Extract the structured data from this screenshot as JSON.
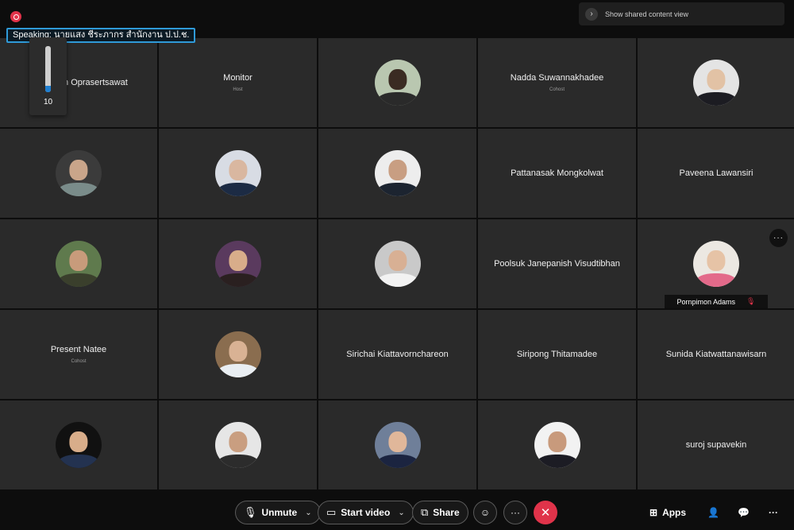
{
  "speaking_label": "Speaking: นายแสง ชีระภากร สำนักงาน ป.ป.ช.",
  "shared_content": {
    "label": "Show shared content view",
    "icon": "chevron-right-icon"
  },
  "volume": {
    "value": "10",
    "level": 0.14
  },
  "participants": [
    {
      "name": "Mongkorn Oprasertsawat",
      "role": "",
      "avatar": null
    },
    {
      "name": "Monitor",
      "role": "Host",
      "avatar": null
    },
    {
      "name": "",
      "role": "",
      "avatar": {
        "bg": "#b9c7b0",
        "skin": "#3a2b22",
        "shirt": "#2a2a2a"
      }
    },
    {
      "name": "Nadda Suwannakhadee",
      "role": "Cohost",
      "avatar": null
    },
    {
      "name": "",
      "role": "",
      "avatar": {
        "bg": "#e4e4e4",
        "skin": "#e2c2a5",
        "shirt": "#1c1c22"
      }
    },
    {
      "name": "",
      "role": "",
      "avatar": {
        "bg": "#3b3b3b",
        "skin": "#c9a58a",
        "shirt": "#7a8c8a"
      }
    },
    {
      "name": "",
      "role": "",
      "avatar": {
        "bg": "#d8dce4",
        "skin": "#d9b7a0",
        "shirt": "#1c2b44"
      }
    },
    {
      "name": "",
      "role": "",
      "avatar": {
        "bg": "#ededed",
        "skin": "#c89e82",
        "shirt": "#1c2430"
      }
    },
    {
      "name": "Pattanasak Mongkolwat",
      "role": "",
      "avatar": null
    },
    {
      "name": "Paveena Lawansiri",
      "role": "",
      "avatar": null
    },
    {
      "name": "",
      "role": "",
      "avatar": {
        "bg": "#5f7a4d",
        "skin": "#c89b7b",
        "shirt": "#3a3f2c"
      }
    },
    {
      "name": "",
      "role": "",
      "avatar": {
        "bg": "#5a3a5e",
        "skin": "#d8ad8a",
        "shirt": "#2a2020"
      }
    },
    {
      "name": "",
      "role": "",
      "avatar": {
        "bg": "#c9c9c9",
        "skin": "#d8b094",
        "shirt": "#f2f2f2"
      }
    },
    {
      "name": "Poolsuk Janepanish Visudtibhan",
      "role": "",
      "avatar": null
    },
    {
      "name": "",
      "role": "",
      "avatar": {
        "bg": "#ece8e2",
        "skin": "#e6c3a6",
        "shirt": "#e36a8a"
      },
      "name_tag": "Pornpimon Adams",
      "menu": "···"
    },
    {
      "name": "Present Natee",
      "role": "Cohost",
      "avatar": null
    },
    {
      "name": "",
      "role": "",
      "avatar": {
        "bg": "#8a6d4f",
        "skin": "#d9b294",
        "shirt": "#e9eef2"
      }
    },
    {
      "name": "Sirichai Kiattavornchareon",
      "role": "",
      "avatar": null
    },
    {
      "name": "Siripong Thitamadee",
      "role": "",
      "avatar": null
    },
    {
      "name": "Sunida Kiatwattanawisarn",
      "role": "",
      "avatar": null
    },
    {
      "name": "",
      "role": "",
      "avatar": {
        "bg": "#111111",
        "skin": "#d8ad8a",
        "shirt": "#233250"
      }
    },
    {
      "name": "",
      "role": "",
      "avatar": {
        "bg": "#e6e6e6",
        "skin": "#c99e80",
        "shirt": "#2c2c2c"
      }
    },
    {
      "name": "",
      "role": "",
      "avatar": {
        "bg": "#6f7f99",
        "skin": "#e0b79a",
        "shirt": "#1b2440"
      }
    },
    {
      "name": "",
      "role": "",
      "avatar": {
        "bg": "#f2f2f2",
        "skin": "#c89a7c",
        "shirt": "#1c1c24"
      }
    },
    {
      "name": "suroj supavekin",
      "role": "",
      "avatar": null
    }
  ],
  "toolbar": {
    "unmute": "Unmute",
    "start_video": "Start video",
    "share": "Share",
    "reactions_icon": "smiley-icon",
    "more": "···",
    "end_icon": "x-icon",
    "apps": "Apps",
    "participants_icon": "person-icon",
    "chat_icon": "chat-bubble-icon",
    "overflow": "···"
  },
  "colors": {
    "accent": "#2f9ad8",
    "danger": "#e0334a",
    "tile": "#2a2a2a"
  }
}
